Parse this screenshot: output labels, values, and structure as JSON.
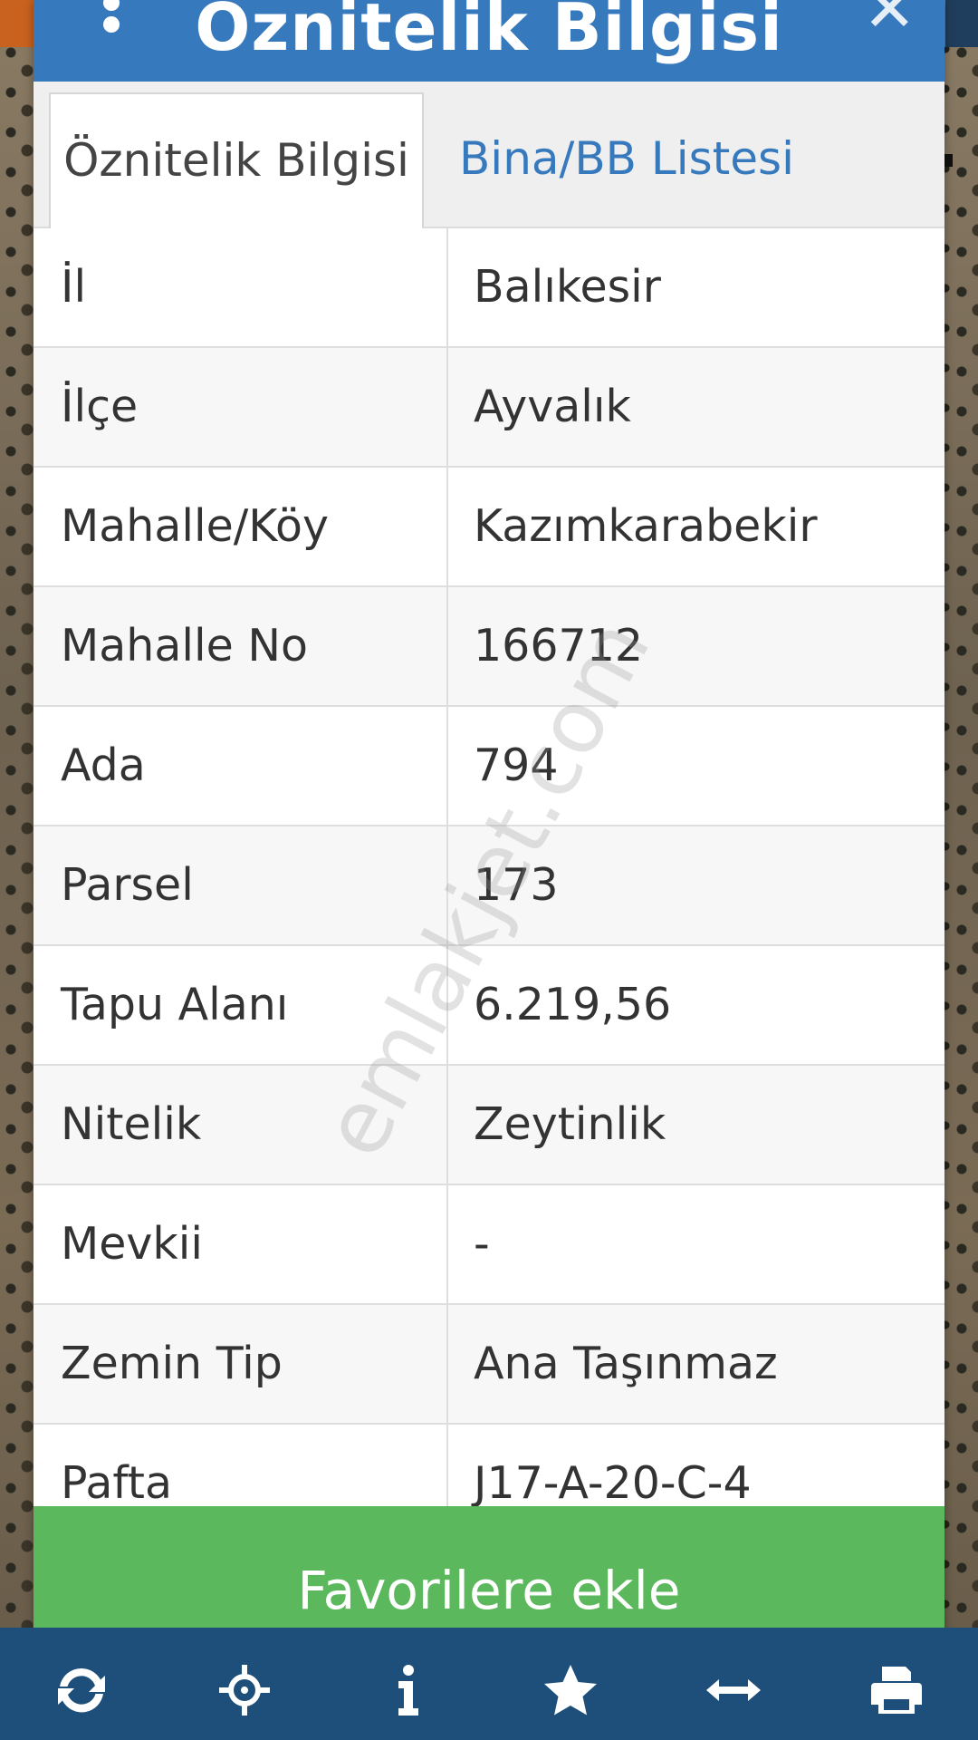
{
  "dialog": {
    "title": "Öznitelik Bilgisi",
    "tabs": [
      {
        "label": "Öznitelik Bilgisi",
        "active": true
      },
      {
        "label": "Bina/BB Listesi",
        "active": false
      }
    ],
    "rows": [
      {
        "label": "İl",
        "value": "Balıkesir"
      },
      {
        "label": "İlçe",
        "value": "Ayvalık"
      },
      {
        "label": "Mahalle/Köy",
        "value": "Kazımkarabekir"
      },
      {
        "label": "Mahalle No",
        "value": "166712"
      },
      {
        "label": "Ada",
        "value": "794"
      },
      {
        "label": "Parsel",
        "value": "173"
      },
      {
        "label": "Tapu Alanı",
        "value": "6.219,56"
      },
      {
        "label": "Nitelik",
        "value": "Zeytinlik"
      },
      {
        "label": "Mevkii",
        "value": "-"
      },
      {
        "label": "Zemin Tip",
        "value": "Ana Taşınmaz"
      },
      {
        "label": "Pafta",
        "value": "J17-A-20-C-4"
      }
    ],
    "favorite_button_label": "Favorilere ekle"
  },
  "watermark": "emlakjet.com",
  "toolbar": {
    "icons": [
      "refresh-icon",
      "crosshair-icon",
      "info-icon",
      "star-icon",
      "arrows-horizontal-icon",
      "printer-icon"
    ]
  },
  "colors": {
    "header": "#3779bd",
    "tab_link": "#3779bd",
    "button": "#5cb85c",
    "toolbar": "#1d4f7a"
  }
}
